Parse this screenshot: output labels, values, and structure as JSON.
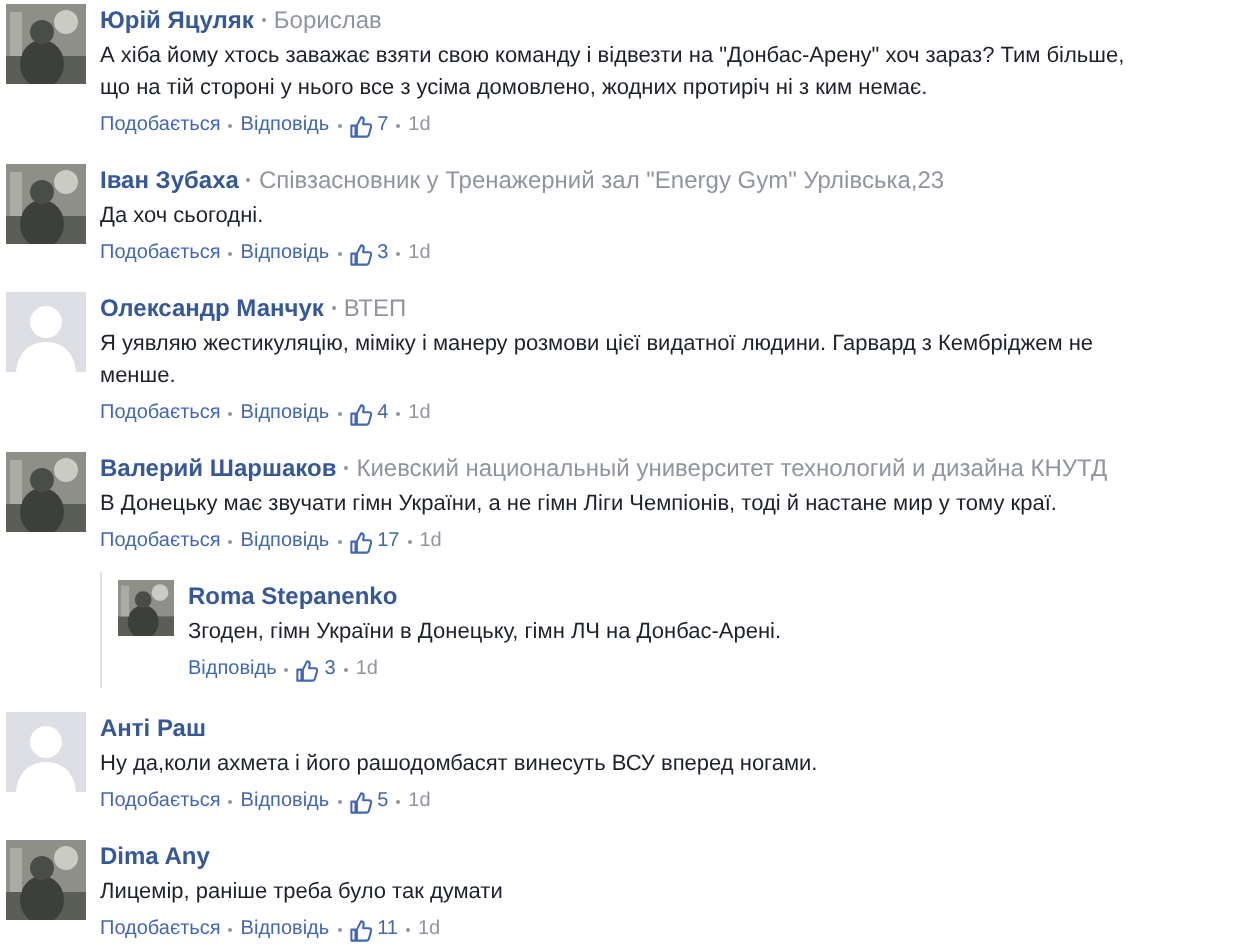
{
  "comments": [
    {
      "avatar": {
        "kind": "picture"
      },
      "name": "Юрій Яцуляк",
      "affiliation": "Борислав",
      "text": "А хіба йому хтось заважає взяти свою команду і відвезти на \"Донбас-Арену\" хоч зараз? Тим більше, що на тій стороні у нього все з усіма домовлено, жодних протиріч ні з ким немає.",
      "actions": [
        "Подобається",
        "Відповідь"
      ],
      "likes": "7",
      "time": "1d"
    },
    {
      "avatar": {
        "kind": "picture"
      },
      "name": "Іван Зубаха",
      "affiliation": "Співзасновник у Тренажерний зал \"Energy Gym\" Урлівська,23",
      "text": "Да хоч сьогодні.",
      "actions": [
        "Подобається",
        "Відповідь"
      ],
      "likes": "3",
      "time": "1d"
    },
    {
      "avatar": {
        "kind": "default"
      },
      "name": "Олександр Манчук",
      "affiliation": "ВТЕП",
      "text": "Я уявляю жестикуляцію, міміку і манеру розмови цієї видатної людини. Гарвард з Кембріджем не менше.",
      "actions": [
        "Подобається",
        "Відповідь"
      ],
      "likes": "4",
      "time": "1d"
    },
    {
      "avatar": {
        "kind": "picture"
      },
      "name": "Валерий Шаршаков",
      "affiliation": "Киевский национальный университет технологий и дизайна КНУТД",
      "text": "В Донецьку має звучати гімн України, а не гімн Ліги Чемпіонів, тоді й настане мир у тому краї.",
      "actions": [
        "Подобається",
        "Відповідь"
      ],
      "likes": "17",
      "time": "1d",
      "replies": [
        {
          "avatar": {
            "kind": "picture"
          },
          "name": "Roma Stepanenko",
          "text": "Згоден, гімн України в Донецьку, гімн ЛЧ на Донбас-Арені.",
          "actions": [
            "Відповідь"
          ],
          "likes": "3",
          "time": "1d"
        }
      ]
    },
    {
      "avatar": {
        "kind": "default"
      },
      "name": "Анті Раш",
      "text": "Ну да,коли ахмета і його рашодомбасят винесуть ВСУ вперед ногами.",
      "actions": [
        "Подобається",
        "Відповідь"
      ],
      "likes": "5",
      "time": "1d"
    },
    {
      "avatar": {
        "kind": "picture"
      },
      "name": "Dima Any",
      "text": "Лицемір, раніше треба було так думати",
      "actions": [
        "Подобається",
        "Відповідь"
      ],
      "likes": "11",
      "time": "1d"
    }
  ]
}
